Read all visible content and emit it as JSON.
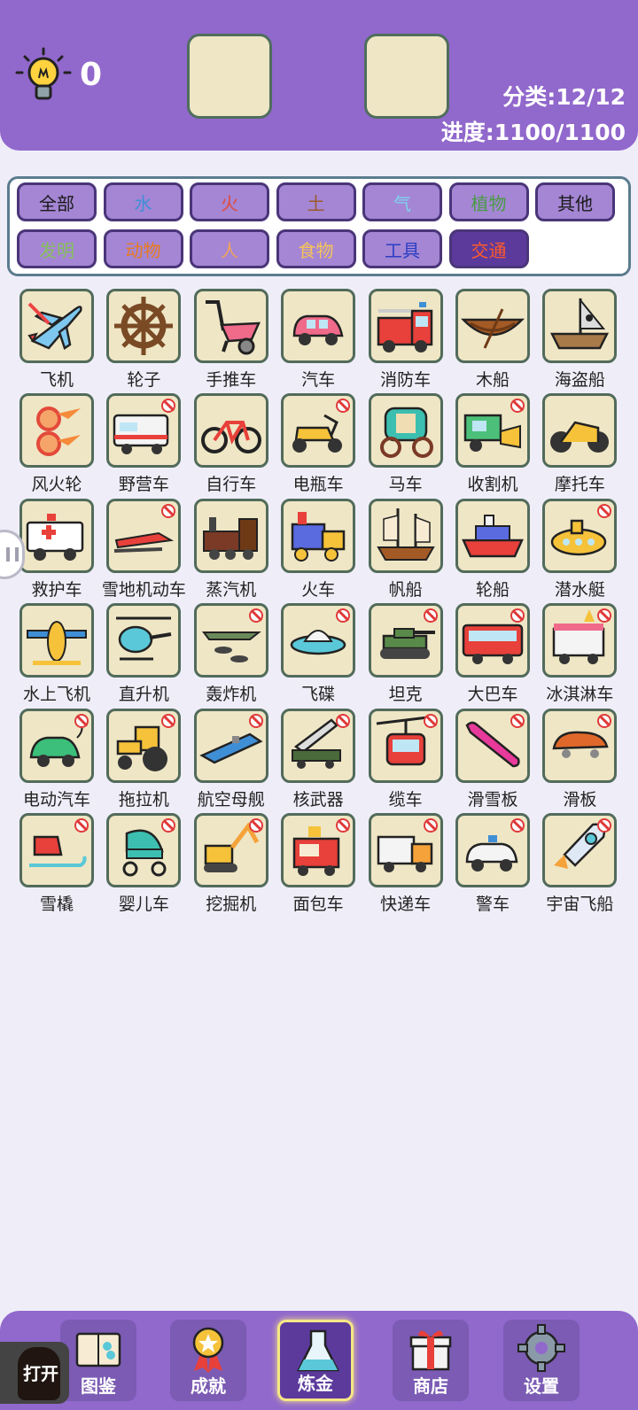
{
  "header": {
    "hint_icon": "lightbulb-icon",
    "hint_count": "0",
    "category_progress": "分类:12/12",
    "overall_progress": "进度:1100/1100"
  },
  "categories": [
    {
      "label": "全部",
      "color": "#1a1a1a",
      "active": false
    },
    {
      "label": "水",
      "color": "#3f8fd6",
      "active": false
    },
    {
      "label": "火",
      "color": "#e34a3a",
      "active": false
    },
    {
      "label": "土",
      "color": "#9a5a2a",
      "active": false
    },
    {
      "label": "气",
      "color": "#7fd3ee",
      "active": false
    },
    {
      "label": "植物",
      "color": "#4c9a48",
      "active": false
    },
    {
      "label": "其他",
      "color": "#1a1a1a",
      "active": false
    },
    {
      "label": "发明",
      "color": "#86c05a",
      "active": false
    },
    {
      "label": "动物",
      "color": "#e77a20",
      "active": false
    },
    {
      "label": "人",
      "color": "#f2a35a",
      "active": false
    },
    {
      "label": "食物",
      "color": "#f4c35a",
      "active": false
    },
    {
      "label": "工具",
      "color": "#2b3fc4",
      "active": false
    },
    {
      "label": "交通",
      "color": "#ff5a2a",
      "active": true
    }
  ],
  "items": [
    {
      "label": "飞机",
      "icon": "airplane-icon",
      "locked": false
    },
    {
      "label": "轮子",
      "icon": "ship-wheel-icon",
      "locked": false
    },
    {
      "label": "手推车",
      "icon": "wheelbarrow-icon",
      "locked": false
    },
    {
      "label": "汽车",
      "icon": "car-icon",
      "locked": false
    },
    {
      "label": "消防车",
      "icon": "fire-truck-icon",
      "locked": false
    },
    {
      "label": "木船",
      "icon": "rowboat-icon",
      "locked": false
    },
    {
      "label": "海盗船",
      "icon": "pirate-ship-icon",
      "locked": false
    },
    {
      "label": "风火轮",
      "icon": "fire-wheels-icon",
      "locked": false
    },
    {
      "label": "野营车",
      "icon": "camper-van-icon",
      "locked": true
    },
    {
      "label": "自行车",
      "icon": "bicycle-icon",
      "locked": false
    },
    {
      "label": "电瓶车",
      "icon": "electric-scooter-icon",
      "locked": true
    },
    {
      "label": "马车",
      "icon": "carriage-icon",
      "locked": false
    },
    {
      "label": "收割机",
      "icon": "harvester-icon",
      "locked": true
    },
    {
      "label": "摩托车",
      "icon": "motorcycle-icon",
      "locked": false
    },
    {
      "label": "救护车",
      "icon": "ambulance-icon",
      "locked": false
    },
    {
      "label": "雪地机动车",
      "icon": "snowmobile-icon",
      "locked": true
    },
    {
      "label": "蒸汽机",
      "icon": "steam-locomotive-icon",
      "locked": false
    },
    {
      "label": "火车",
      "icon": "toy-train-icon",
      "locked": false
    },
    {
      "label": "帆船",
      "icon": "sailing-ship-icon",
      "locked": false
    },
    {
      "label": "轮船",
      "icon": "steamship-icon",
      "locked": false
    },
    {
      "label": "潜水艇",
      "icon": "submarine-icon",
      "locked": true
    },
    {
      "label": "水上飞机",
      "icon": "seaplane-icon",
      "locked": false
    },
    {
      "label": "直升机",
      "icon": "helicopter-icon",
      "locked": false
    },
    {
      "label": "轰炸机",
      "icon": "bomber-icon",
      "locked": true
    },
    {
      "label": "飞碟",
      "icon": "ufo-icon",
      "locked": true
    },
    {
      "label": "坦克",
      "icon": "tank-icon",
      "locked": true
    },
    {
      "label": "大巴车",
      "icon": "bus-icon",
      "locked": true
    },
    {
      "label": "冰淇淋车",
      "icon": "ice-cream-truck-icon",
      "locked": true
    },
    {
      "label": "电动汽车",
      "icon": "electric-car-icon",
      "locked": true
    },
    {
      "label": "拖拉机",
      "icon": "tractor-icon",
      "locked": true
    },
    {
      "label": "航空母舰",
      "icon": "aircraft-carrier-icon",
      "locked": true
    },
    {
      "label": "核武器",
      "icon": "missile-launcher-icon",
      "locked": true
    },
    {
      "label": "缆车",
      "icon": "cable-car-icon",
      "locked": true
    },
    {
      "label": "滑雪板",
      "icon": "snowboard-icon",
      "locked": true
    },
    {
      "label": "滑板",
      "icon": "skateboard-icon",
      "locked": true
    },
    {
      "label": "雪橇",
      "icon": "sled-icon",
      "locked": true
    },
    {
      "label": "婴儿车",
      "icon": "stroller-icon",
      "locked": true
    },
    {
      "label": "挖掘机",
      "icon": "excavator-icon",
      "locked": true
    },
    {
      "label": "面包车",
      "icon": "food-truck-icon",
      "locked": true
    },
    {
      "label": "快递车",
      "icon": "delivery-truck-icon",
      "locked": true
    },
    {
      "label": "警车",
      "icon": "police-car-icon",
      "locked": true
    },
    {
      "label": "宇宙飞船",
      "icon": "rocket-icon",
      "locked": true
    }
  ],
  "nav": [
    {
      "label": "图鉴",
      "icon": "book-icon",
      "active": false
    },
    {
      "label": "成就",
      "icon": "medal-icon",
      "active": false
    },
    {
      "label": "炼金",
      "icon": "flask-icon",
      "active": true
    },
    {
      "label": "商店",
      "icon": "gift-icon",
      "active": false
    },
    {
      "label": "设置",
      "icon": "gear-icon",
      "active": false
    }
  ],
  "open_button": {
    "label": "打开"
  }
}
